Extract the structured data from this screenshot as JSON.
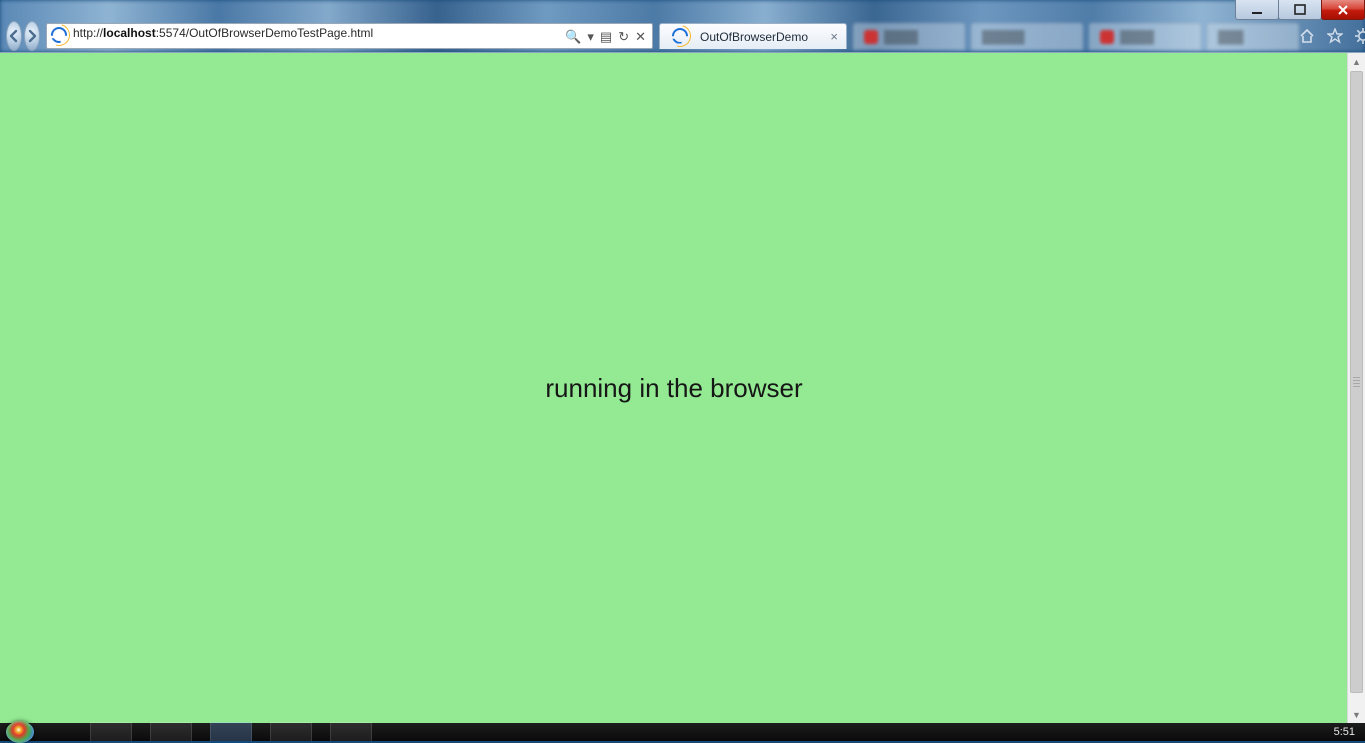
{
  "window_controls": {
    "minimize": "minimize",
    "maximize": "maximize",
    "close": "close"
  },
  "nav": {
    "back": "back",
    "forward": "forward"
  },
  "address": {
    "scheme": "http://",
    "host": "localhost",
    "port_path": ":5574/OutOfBrowserDemoTestPage.html",
    "full": "http://localhost:5574/OutOfBrowserDemoTestPage.html",
    "search_icon": "search",
    "dropdown_icon": "dropdown",
    "compat_icon": "compatibility-view",
    "refresh_icon": "refresh",
    "stop_icon": "stop"
  },
  "tabs": {
    "active": {
      "title": "OutOfBrowserDemo",
      "close": "×"
    }
  },
  "toolbar_icons": {
    "home": "home",
    "favorites": "favorites",
    "tools": "tools"
  },
  "page": {
    "background": "#93ea93",
    "message": "running in the browser"
  },
  "taskbar": {
    "clock": "5:51"
  }
}
